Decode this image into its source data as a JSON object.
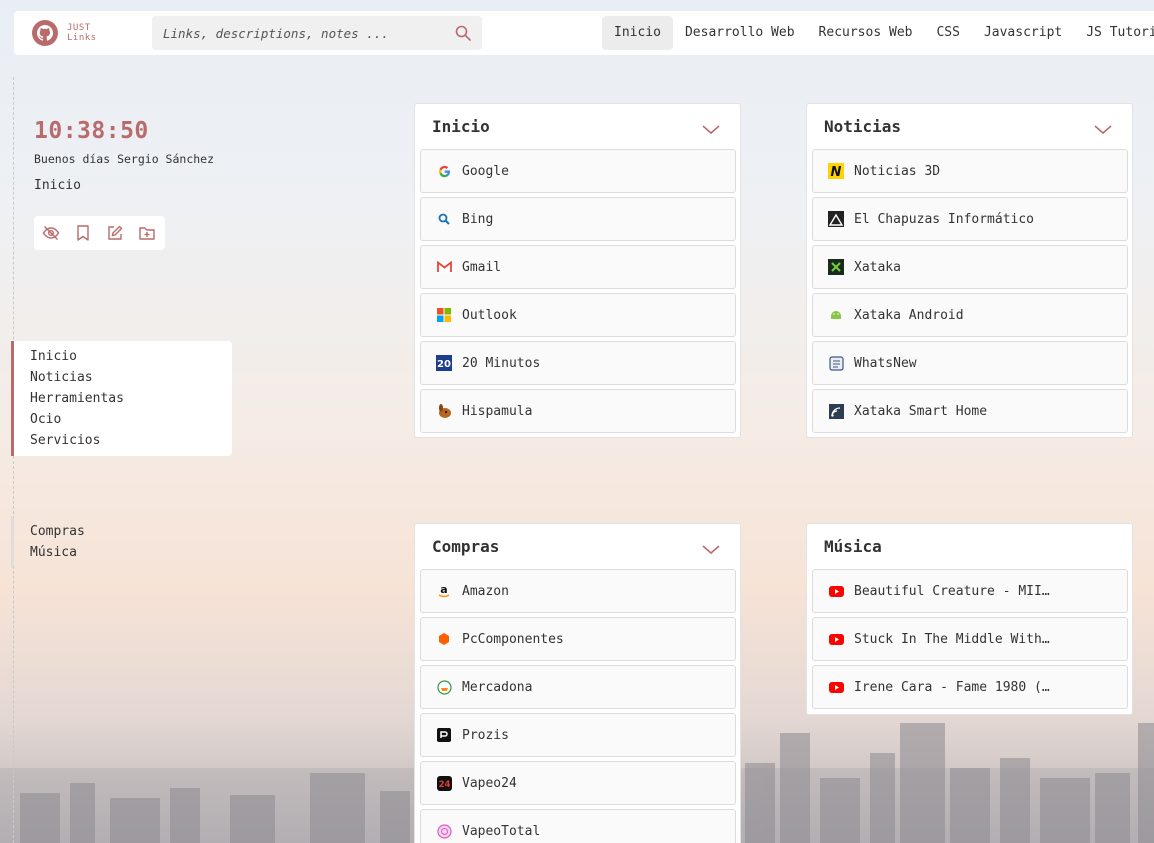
{
  "header": {
    "logo_line1": "JUST",
    "logo_line2": "Links",
    "search_placeholder": "Links, descriptions, notes ...",
    "nav": [
      "Inicio",
      "Desarrollo Web",
      "Recursos Web",
      "CSS",
      "Javascript",
      "JS Tutoria"
    ],
    "active_nav": "Inicio"
  },
  "sidebar": {
    "clock": "10:38:50",
    "greeting": "Buenos días Sergio Sánchez",
    "current_page": "Inicio",
    "actions": [
      "hide-icon",
      "bookmark-icon",
      "edit-icon",
      "add-folder-icon"
    ],
    "group1": [
      "Inicio",
      "Noticias",
      "Herramientas",
      "Ocio",
      "Servicios"
    ],
    "group2": [
      "Compras",
      "Música"
    ]
  },
  "cards": {
    "inicio": {
      "title": "Inicio",
      "links": [
        "Google",
        "Bing",
        "Gmail",
        "Outlook",
        "20 Minutos",
        "Hispamula"
      ]
    },
    "noticias": {
      "title": "Noticias",
      "links": [
        "Noticias 3D",
        "El Chapuzas Informático",
        "Xataka",
        "Xataka Android",
        "WhatsNew",
        "Xataka Smart Home"
      ]
    },
    "compras": {
      "title": "Compras",
      "links": [
        "Amazon",
        "PcComponentes",
        "Mercadona",
        "Prozis",
        "Vapeo24",
        "VapeoTotal"
      ]
    },
    "musica": {
      "title": "Música",
      "links": [
        "Beautiful Creature - MII…",
        "Stuck In The Middle With…",
        "Irene Cara - Fame 1980 (…"
      ]
    }
  },
  "colors": {
    "accent": "#b96b6b"
  }
}
